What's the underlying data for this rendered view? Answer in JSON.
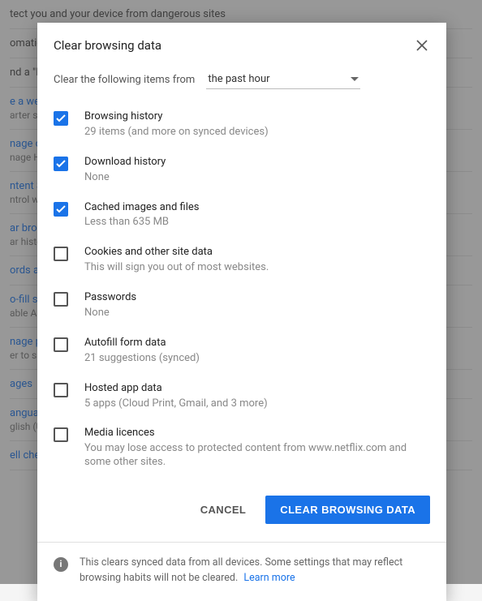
{
  "dialog": {
    "title": "Clear browsing data",
    "time_label": "Clear the following items from",
    "time_value": "the past hour",
    "cancel": "CANCEL",
    "confirm": "CLEAR BROWSING DATA",
    "footer_note": "This clears synced data from all devices. Some settings that may reflect browsing habits will not be cleared.",
    "learn_more": "Learn more"
  },
  "items": [
    {
      "checked": true,
      "label": "Browsing history",
      "sub": "29 items (and more on synced devices)"
    },
    {
      "checked": true,
      "label": "Download history",
      "sub": "None"
    },
    {
      "checked": true,
      "label": "Cached images and files",
      "sub": "Less than 635 MB"
    },
    {
      "checked": false,
      "label": "Cookies and other site data",
      "sub": "This will sign you out of most websites."
    },
    {
      "checked": false,
      "label": "Passwords",
      "sub": "None"
    },
    {
      "checked": false,
      "label": "Autofill form data",
      "sub": "21 suggestions (synced)"
    },
    {
      "checked": false,
      "label": "Hosted app data",
      "sub": "5 apps (Cloud Print, Gmail, and 3 more)"
    },
    {
      "checked": false,
      "label": "Media licences",
      "sub": "You may lose access to protected content from www.netflix.com and some other sites."
    }
  ],
  "bg": {
    "r1": "tect you and your device from dangerous sites",
    "r2": "omatica",
    "r3": "nd a \"Do",
    "r4a": "e a web",
    "r4b": "arter sp",
    "r5a": "nage ce",
    "r5b": "nage HT",
    "r6a": "ntent Se",
    "r6b": "ntrol wh",
    "r7a": "ar brows",
    "r7b": "ar histor",
    "r8": "ords and",
    "r9a": "o-fill set",
    "r9b": "able Aut",
    "r10a": "nage pa",
    "r10b": "er to sav",
    "r11": "ages",
    "r12a": "anguage",
    "r12b": "glish (Un",
    "r13": "ell check"
  }
}
